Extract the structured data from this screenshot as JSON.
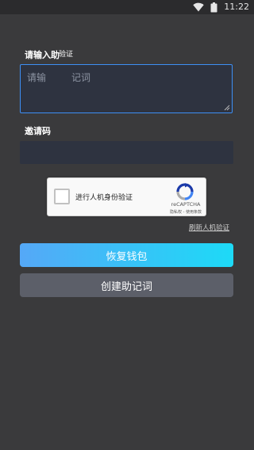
{
  "status_bar": {
    "time": "11:22"
  },
  "form": {
    "mnemonic_label": "请输入助",
    "mnemonic_label_overlap": "验证",
    "mnemonic_placeholder_start": "请输",
    "mnemonic_placeholder_end": "记词",
    "invite_label": "邀请码"
  },
  "captcha": {
    "label": "进行人机身份验证",
    "brand": "reCAPTCHA",
    "terms": "隐私权 - 使用条款"
  },
  "refresh_link": "刷新人机验证",
  "buttons": {
    "restore_wallet": "恢复钱包",
    "create_mnemonic": "创建助记词"
  },
  "colors": {
    "background": "#3a3a3c",
    "input_bg": "#2e3340",
    "focus_border": "#3d8ff5",
    "gradient_start": "#55a8f7",
    "gradient_end": "#1ddaf7",
    "secondary_button": "#5c5f69"
  },
  "icons": {
    "status": [
      "wifi-icon",
      "battery-icon"
    ],
    "captcha": "recaptcha-logo-icon"
  }
}
